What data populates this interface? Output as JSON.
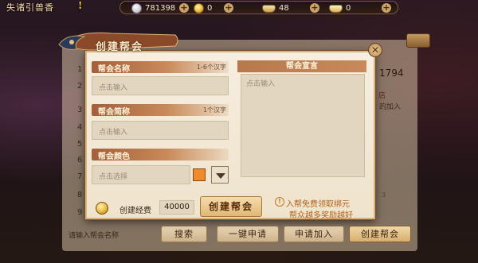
{
  "topbar": {
    "quest_text": "失诸引兽香",
    "quest_alert": "!",
    "resources": [
      {
        "icon": "silver-coin-icon",
        "value": "781398",
        "color": "#c8c8d0"
      },
      {
        "icon": "gold-coin-icon",
        "value": "0",
        "color": "#e8b840"
      },
      {
        "icon": "gold-ingot-icon",
        "value": "48",
        "color": "#e2c27a"
      },
      {
        "icon": "bound-ingot-icon",
        "value": "0",
        "color": "#e6c680"
      }
    ]
  },
  "guild_list": {
    "row_numbers": [
      "1",
      "2",
      "3",
      "4",
      "5",
      "6",
      "7",
      "8",
      "9"
    ],
    "peek_number": "1794",
    "peek_text1": "店",
    "peek_text2": "的加入",
    "peek_small": "3",
    "search_placeholder": "请输入帮会名称",
    "buttons": {
      "search": "搜索",
      "quick_apply": "一键申请",
      "apply_join": "申请加入",
      "create_guild": "创建帮会"
    }
  },
  "dialog": {
    "title": "创建帮会",
    "close_symbol": "✕",
    "name_section": {
      "label": "帮会名称",
      "hint": "1-6个汉字",
      "placeholder": "点击输入"
    },
    "short_section": {
      "label": "帮会简称",
      "hint": "1个汉字",
      "placeholder": "点击输入"
    },
    "color_section": {
      "label": "帮会颜色",
      "placeholder": "点击选择",
      "selected_color": "#f08a2a"
    },
    "cost": {
      "label": "创建经费",
      "value": "40000"
    },
    "create_button": "创建帮会",
    "declaration": {
      "label": "帮会宣言",
      "placeholder": "点击输入"
    },
    "tip": {
      "line1": "入帮免费领取绑元",
      "line2": "帮众越多奖励越好"
    }
  }
}
